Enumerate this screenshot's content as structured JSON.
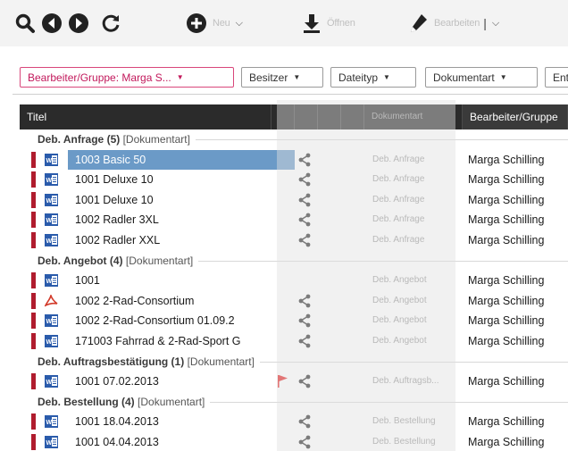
{
  "toolbar": {
    "new_label": "Neu",
    "open_label": "Öffnen",
    "edit_label": "Bearbeiten"
  },
  "filters": [
    {
      "label": "Bearbeiter/Gruppe: Marga S...",
      "active": true
    },
    {
      "label": "Besitzer",
      "active": false
    },
    {
      "label": "Dateityp",
      "active": false
    },
    {
      "label": "Dokumentart",
      "active": false
    },
    {
      "label": "Ent",
      "active": false
    }
  ],
  "columns": {
    "title": "Titel",
    "doctype": "Dokumentart",
    "assignee": "Bearbeiter/Gruppe"
  },
  "groups": [
    {
      "name": "Deb. Anfrage (5)",
      "sub": "[Dokumentart]",
      "rows": [
        {
          "title": "1003 Basic 50",
          "type": "Deb. Anfrage",
          "assignee": "Marga Schilling",
          "icon": "word",
          "selected": true,
          "share": true,
          "flag": false
        },
        {
          "title": "1001 Deluxe 10",
          "type": "Deb. Anfrage",
          "assignee": "Marga Schilling",
          "icon": "word",
          "selected": false,
          "share": true,
          "flag": false
        },
        {
          "title": "1001 Deluxe 10",
          "type": "Deb. Anfrage",
          "assignee": "Marga Schilling",
          "icon": "word",
          "selected": false,
          "share": true,
          "flag": false
        },
        {
          "title": "1002 Radler 3XL",
          "type": "Deb. Anfrage",
          "assignee": "Marga Schilling",
          "icon": "word",
          "selected": false,
          "share": true,
          "flag": false
        },
        {
          "title": "1002 Radler XXL",
          "type": "Deb. Anfrage",
          "assignee": "Marga Schilling",
          "icon": "word",
          "selected": false,
          "share": true,
          "flag": false
        }
      ]
    },
    {
      "name": "Deb. Angebot (4)",
      "sub": "[Dokumentart]",
      "rows": [
        {
          "title": "1001",
          "type": "Deb. Angebot",
          "assignee": "Marga Schilling",
          "icon": "word",
          "selected": false,
          "share": false,
          "flag": false
        },
        {
          "title": "1002 2-Rad-Consortium",
          "type": "Deb. Angebot",
          "assignee": "Marga Schilling",
          "icon": "pdf",
          "selected": false,
          "share": true,
          "flag": false
        },
        {
          "title": "1002 2-Rad-Consortium  01.09.2",
          "type": "Deb. Angebot",
          "assignee": "Marga Schilling",
          "icon": "word",
          "selected": false,
          "share": true,
          "flag": false
        },
        {
          "title": "171003 Fahrrad & 2-Rad-Sport G",
          "type": "Deb. Angebot",
          "assignee": "Marga Schilling",
          "icon": "word",
          "selected": false,
          "share": true,
          "flag": false
        }
      ]
    },
    {
      "name": "Deb. Auftragsbestätigung (1)",
      "sub": "[Dokumentart]",
      "rows": [
        {
          "title": "1001   07.02.2013",
          "type": "Deb. Auftragsb...",
          "assignee": "Marga Schilling",
          "icon": "word",
          "selected": false,
          "share": true,
          "flag": true
        }
      ]
    },
    {
      "name": "Deb. Bestellung (4)",
      "sub": "[Dokumentart]",
      "rows": [
        {
          "title": "1001   18.04.2013",
          "type": "Deb. Bestellung",
          "assignee": "Marga Schilling",
          "icon": "word",
          "selected": false,
          "share": true,
          "flag": false
        },
        {
          "title": "1001   04.04.2013",
          "type": "Deb. Bestellung",
          "assignee": "Marga Schilling",
          "icon": "word",
          "selected": false,
          "share": true,
          "flag": false
        }
      ]
    }
  ],
  "colors": {
    "accent": "#c2185b",
    "selection": "#6b9ac7",
    "status_bar": "#b01c2e",
    "header_bg": "#2b2b2b"
  }
}
